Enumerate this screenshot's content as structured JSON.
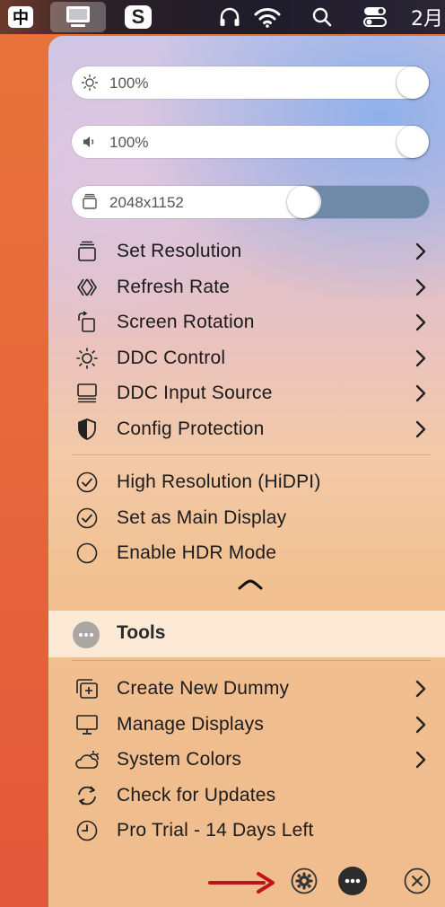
{
  "menubar": {
    "ime_label": "中",
    "s_label": "S",
    "date_text": "2月"
  },
  "sliders": {
    "brightness": {
      "value": "100%",
      "level": 1.0
    },
    "volume": {
      "value": "100%",
      "level": 1.0
    },
    "resolution": {
      "value": "2048x1152",
      "level": 0.65
    }
  },
  "menu": {
    "items": [
      {
        "label": "Set Resolution",
        "icon": "resolution-icon",
        "submenu": true
      },
      {
        "label": "Refresh Rate",
        "icon": "refresh-rate-icon",
        "submenu": true
      },
      {
        "label": "Screen Rotation",
        "icon": "rotation-icon",
        "submenu": true
      },
      {
        "label": "DDC Control",
        "icon": "ddc-control-icon",
        "submenu": true
      },
      {
        "label": "DDC Input Source",
        "icon": "input-source-icon",
        "submenu": true
      },
      {
        "label": "Config Protection",
        "icon": "shield-icon",
        "submenu": true
      }
    ],
    "toggles": [
      {
        "label": "High Resolution (HiDPI)",
        "checked": true
      },
      {
        "label": "Set as Main Display",
        "checked": true
      },
      {
        "label": "Enable HDR Mode",
        "checked": false
      }
    ]
  },
  "tools": {
    "label": "Tools",
    "items": [
      {
        "label": "Create New Dummy",
        "icon": "add-display-icon",
        "submenu": true
      },
      {
        "label": "Manage Displays",
        "icon": "display-icon",
        "submenu": true
      },
      {
        "label": "System Colors",
        "icon": "cloud-sun-icon",
        "submenu": true
      },
      {
        "label": "Check for Updates",
        "icon": "refresh-icon",
        "submenu": false
      },
      {
        "label": "Pro Trial - 14 Days Left",
        "icon": "clock-icon",
        "submenu": false
      }
    ]
  },
  "colors": {
    "arrow": "#c0141c",
    "slider_track": "#6f8aa8"
  }
}
